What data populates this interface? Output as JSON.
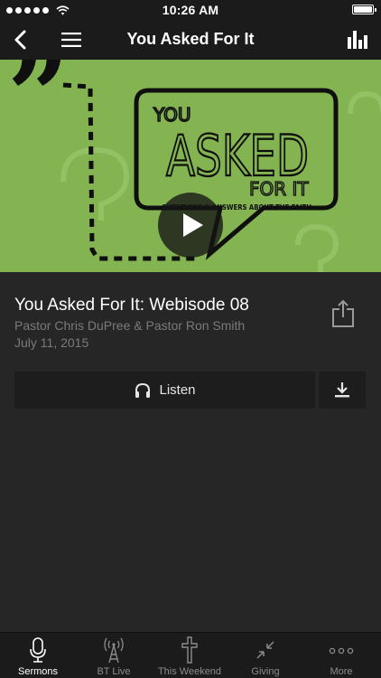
{
  "status_bar": {
    "time": "10:26 AM"
  },
  "nav": {
    "title": "You Asked For It"
  },
  "hero": {
    "art_line1": "YOU",
    "art_line2": "ASKED",
    "art_line3": "FOR IT",
    "art_tagline": "QUESTIONS & ANSWERS ABOUT THE FAITH"
  },
  "episode": {
    "title": "You Asked For It: Webisode 08",
    "speakers": "Pastor Chris DuPree & Pastor Ron Smith",
    "date": "July 11, 2015"
  },
  "actions": {
    "listen_label": "Listen"
  },
  "tabs": [
    {
      "label": "Sermons",
      "icon": "microphone-icon"
    },
    {
      "label": "BT Live",
      "icon": "broadcast-tower-icon"
    },
    {
      "label": "This Weekend",
      "icon": "cross-icon"
    },
    {
      "label": "Giving",
      "icon": "collapse-arrows-icon"
    },
    {
      "label": "More",
      "icon": "more-dots-icon"
    }
  ],
  "colors": {
    "hero_green": "#84b351",
    "background": "#262626",
    "bar": "#1b1b1b"
  }
}
